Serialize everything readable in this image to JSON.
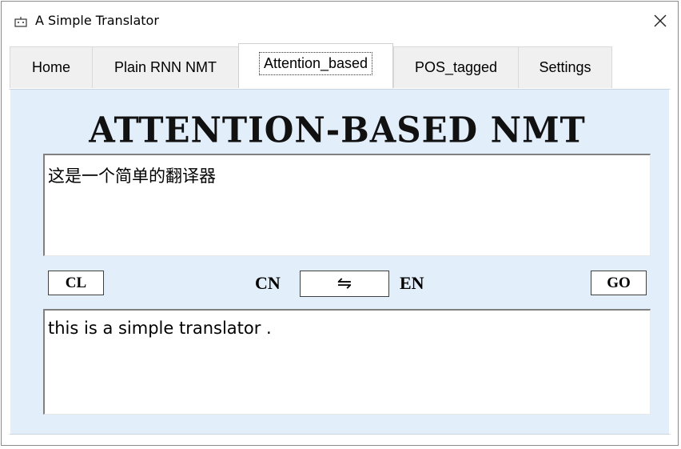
{
  "window": {
    "title": "A Simple Translator",
    "close_icon": "close-icon"
  },
  "tabs": [
    {
      "label": "Home",
      "active": false
    },
    {
      "label": "Plain RNN NMT",
      "active": false
    },
    {
      "label": "Attention_based",
      "active": true
    },
    {
      "label": "POS_tagged",
      "active": false
    },
    {
      "label": "Settings",
      "active": false
    }
  ],
  "main": {
    "heading": "ATTENTION-BASED NMT",
    "source_text": "这是一个简单的翻译器",
    "target_text": "this is a simple translator .",
    "clear_label": "CL",
    "go_label": "GO",
    "source_lang": "CN",
    "target_lang": "EN",
    "swap_icon": "swap-arrows-icon",
    "swap_glyph": "⇋"
  },
  "colors": {
    "panel_background": "#e3eefb",
    "window_background": "#ffffff"
  }
}
